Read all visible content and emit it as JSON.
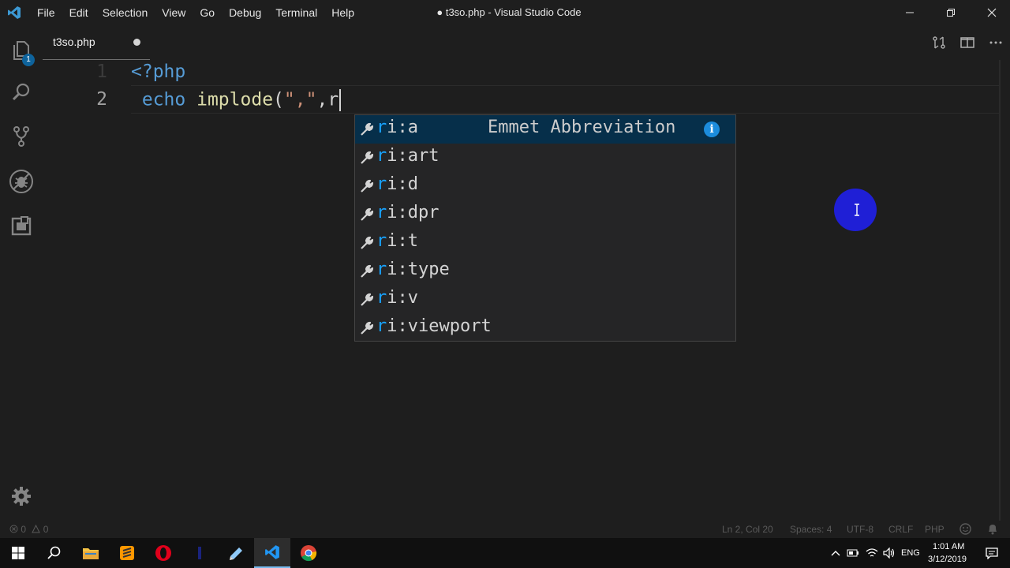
{
  "window": {
    "title": "● t3so.php - Visual Studio Code",
    "menu": [
      "File",
      "Edit",
      "Selection",
      "View",
      "Go",
      "Debug",
      "Terminal",
      "Help"
    ]
  },
  "activity": {
    "explorer_badge": "1"
  },
  "tab": {
    "label": "t3so.php",
    "dirty": true
  },
  "editor": {
    "lines": [
      {
        "number": "1",
        "text": "<?php"
      },
      {
        "number": "2",
        "text": "echo implode(\",\",r"
      }
    ]
  },
  "suggest": {
    "match": "r",
    "items": [
      {
        "label": "ri:a",
        "detail": "Emmet Abbreviation"
      },
      {
        "label": "ri:art"
      },
      {
        "label": "ri:d"
      },
      {
        "label": "ri:dpr"
      },
      {
        "label": "ri:t"
      },
      {
        "label": "ri:type"
      },
      {
        "label": "ri:v"
      },
      {
        "label": "ri:viewport"
      }
    ]
  },
  "status": {
    "errors": "0",
    "warnings": "0",
    "position": "Ln 2, Col 20",
    "spaces": "Spaces: 4",
    "encoding": "UTF-8",
    "eol": "CRLF",
    "language": "PHP"
  },
  "taskbar": {
    "lang": "ENG",
    "time": "1:01 AM",
    "date": "3/12/2019"
  },
  "colors": {
    "accent": "#007acc",
    "match_highlight": "#18a3ff",
    "php_tag": "#569cd6",
    "keyword": "#569cd6",
    "function": "#dcdcaa",
    "string": "#ce9178"
  }
}
